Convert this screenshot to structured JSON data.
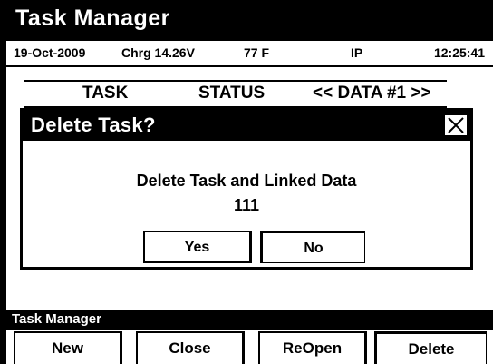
{
  "app": {
    "title": "Task Manager"
  },
  "status_bar": {
    "date": "19-Oct-2009",
    "charge": "Chrg 14.26V",
    "temperature": "77 F",
    "mode": "IP",
    "time": "12:25:41"
  },
  "table_header": {
    "task": "TASK",
    "status": "STATUS",
    "data": "<< DATA #1 >>"
  },
  "dialog": {
    "title": "Delete Task?",
    "close_icon": "close-x-icon",
    "message": "Delete Task and Linked Data",
    "value": "111",
    "yes_label": "Yes",
    "no_label": "No"
  },
  "menu": {
    "title": "Task Manager",
    "buttons": [
      {
        "label": "New"
      },
      {
        "label": "Close"
      },
      {
        "label": "ReOpen"
      },
      {
        "label": "Delete"
      }
    ]
  },
  "colors": {
    "foreground": "#000000",
    "background": "#ffffff"
  }
}
